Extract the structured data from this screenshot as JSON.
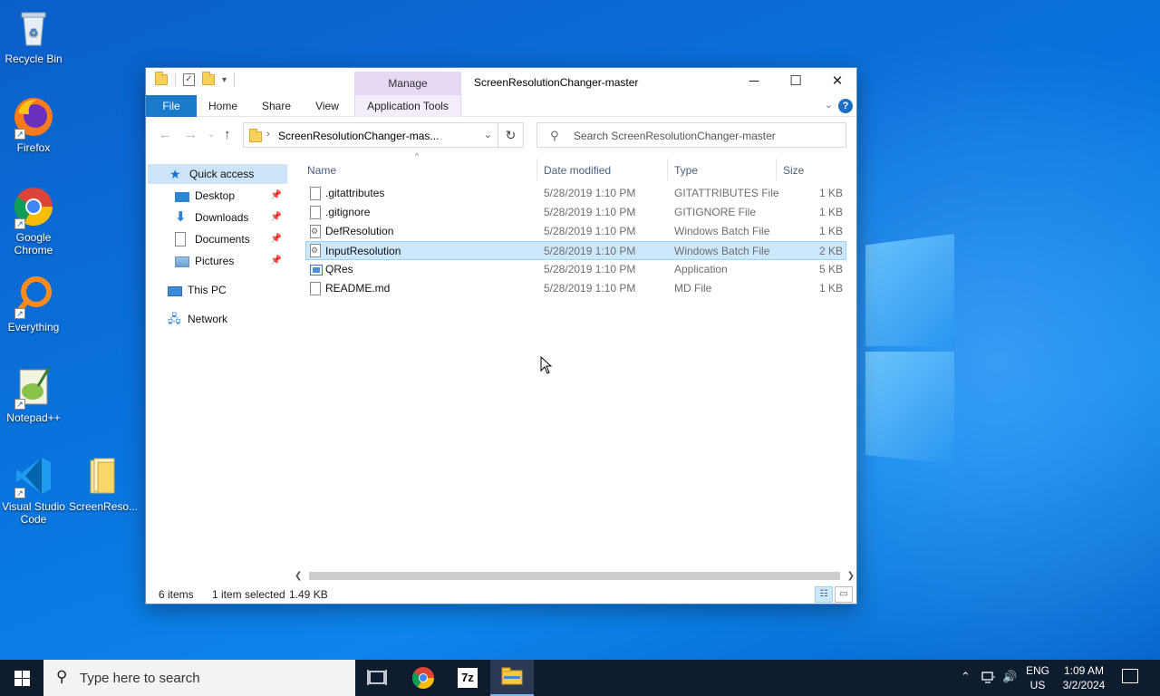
{
  "desktop": {
    "icons": [
      {
        "label": "Recycle Bin"
      },
      {
        "label": "Firefox"
      },
      {
        "label": "Google Chrome"
      },
      {
        "label": "Everything"
      },
      {
        "label": "Notepad++"
      },
      {
        "label": "Visual Studio Code"
      },
      {
        "label": "ScreenReso..."
      }
    ]
  },
  "window": {
    "title": "ScreenResolutionChanger-master",
    "manage_tab": "Manage",
    "ribbon_tabs": {
      "file": "File",
      "home": "Home",
      "share": "Share",
      "view": "View",
      "app_tools": "Application Tools"
    },
    "help": "?",
    "address": "ScreenResolutionChanger-mas...",
    "search_placeholder": "Search ScreenResolutionChanger-master",
    "nav": {
      "quick_access": "Quick access",
      "desktop": "Desktop",
      "downloads": "Downloads",
      "documents": "Documents",
      "pictures": "Pictures",
      "this_pc": "This PC",
      "network": "Network"
    },
    "columns": {
      "name": "Name",
      "date": "Date modified",
      "type": "Type",
      "size": "Size"
    },
    "files": [
      {
        "name": ".gitattributes",
        "date": "5/28/2019 1:10 PM",
        "type": "GITATTRIBUTES File",
        "size": "1 KB"
      },
      {
        "name": ".gitignore",
        "date": "5/28/2019 1:10 PM",
        "type": "GITIGNORE File",
        "size": "1 KB"
      },
      {
        "name": "DefResolution",
        "date": "5/28/2019 1:10 PM",
        "type": "Windows Batch File",
        "size": "1 KB"
      },
      {
        "name": "InputResolution",
        "date": "5/28/2019 1:10 PM",
        "type": "Windows Batch File",
        "size": "2 KB"
      },
      {
        "name": "QRes",
        "date": "5/28/2019 1:10 PM",
        "type": "Application",
        "size": "5 KB"
      },
      {
        "name": "README.md",
        "date": "5/28/2019 1:10 PM",
        "type": "MD File",
        "size": "1 KB"
      }
    ],
    "status": {
      "items": "6 items",
      "selected": "1 item selected",
      "size": "1.49 KB"
    }
  },
  "taskbar": {
    "search_placeholder": "Type here to search",
    "lang_top": "ENG",
    "lang_bottom": "US",
    "time": "1:09 AM",
    "date": "3/2/2024",
    "seven_zip": "7z"
  },
  "colors": {
    "accent": "#1979ca",
    "selection": "#cce8ff",
    "taskbar": "#0f1c2e"
  }
}
